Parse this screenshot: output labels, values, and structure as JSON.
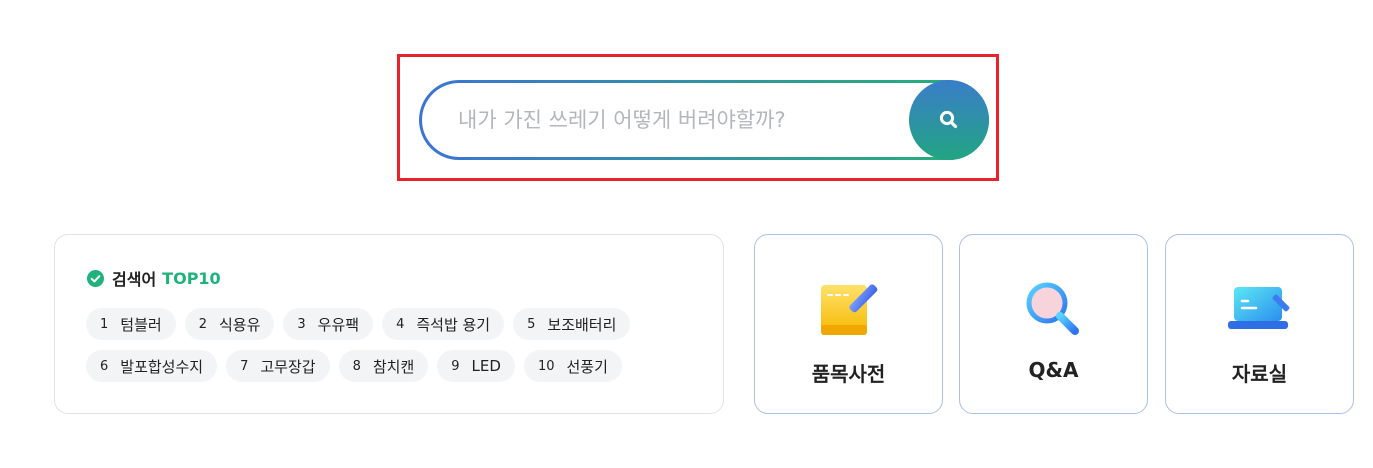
{
  "search": {
    "placeholder": "내가 가진 쓰레기 어떻게 버려야할까?"
  },
  "top_keywords": {
    "title": "검색어",
    "title_accent": "TOP10",
    "items": [
      {
        "rank": "1",
        "label": "텀블러"
      },
      {
        "rank": "2",
        "label": "식용유"
      },
      {
        "rank": "3",
        "label": "우유팩"
      },
      {
        "rank": "4",
        "label": "즉석밥 용기"
      },
      {
        "rank": "5",
        "label": "보조배터리"
      },
      {
        "rank": "6",
        "label": "발포합성수지"
      },
      {
        "rank": "7",
        "label": "고무장갑"
      },
      {
        "rank": "8",
        "label": "참치캔"
      },
      {
        "rank": "9",
        "label": "LED"
      },
      {
        "rank": "10",
        "label": "선풍기"
      }
    ]
  },
  "menu": {
    "dictionary": "품목사전",
    "qna": "Q&A",
    "archive": "자료실"
  },
  "colors": {
    "accent_green": "#1fb27a",
    "accent_blue": "#3b73d6",
    "highlight_red": "#e8232a"
  }
}
